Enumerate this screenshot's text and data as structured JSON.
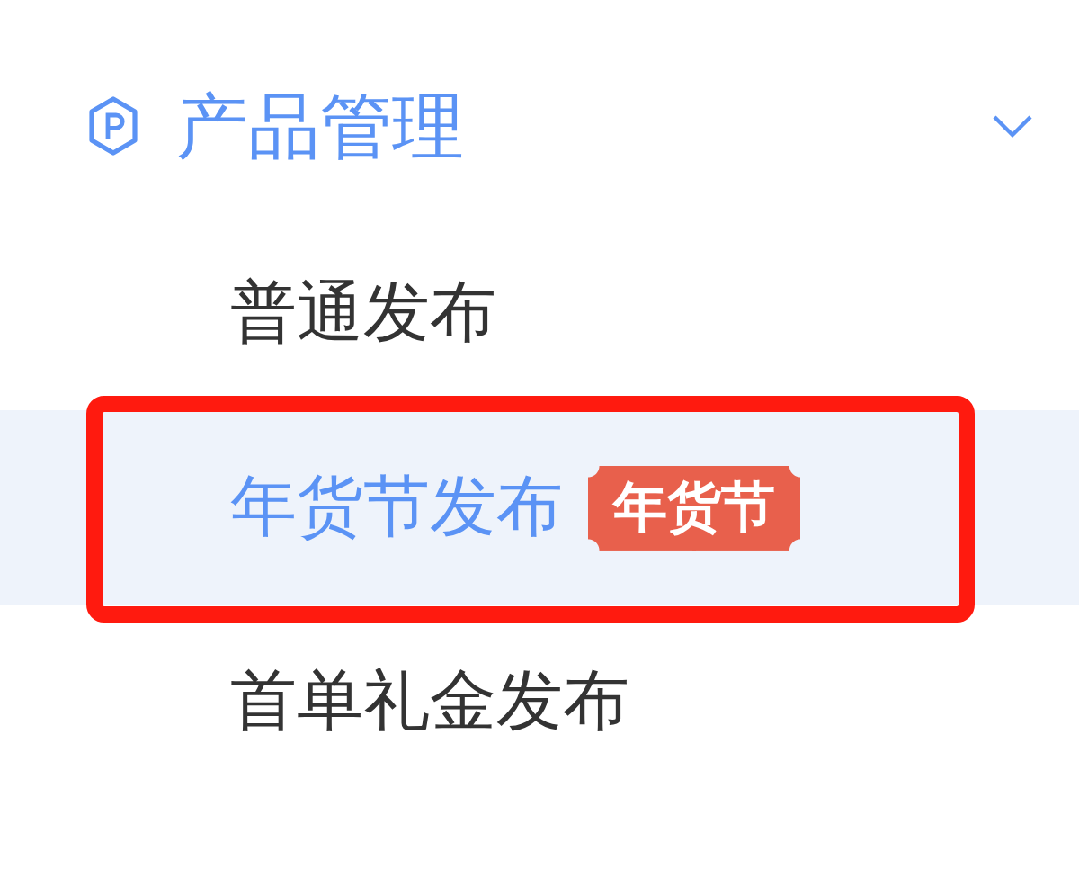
{
  "menu_group": {
    "label": "产品管理",
    "expanded": true,
    "items": [
      {
        "label": "普通发布",
        "selected": false,
        "highlighted": false
      },
      {
        "label": "年货节发布",
        "selected": true,
        "highlighted": true,
        "badge": "年货节"
      },
      {
        "label": "首单礼金发布",
        "selected": false,
        "highlighted": false
      }
    ]
  }
}
